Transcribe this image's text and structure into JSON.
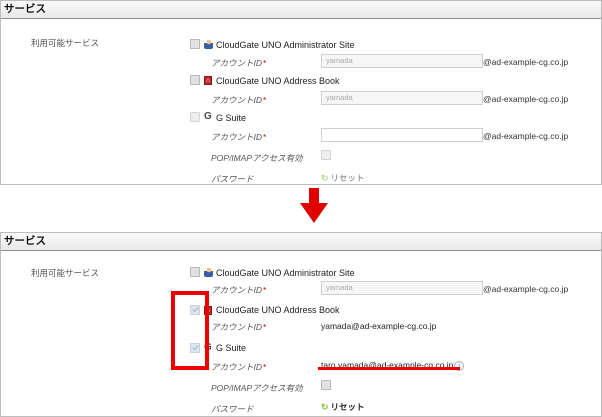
{
  "section_title": "サービス",
  "available_services_label": "利用可能サービス",
  "account_id_label": "アカウントID",
  "required_mark": "*",
  "domain_suffix": "@ad-example-cg.co.jp",
  "pop_imap_label": "POP/IMAPアクセス有効",
  "password_label": "パスワード",
  "reset_label": "リセット",
  "services": {
    "admin": "CloudGate UNO Administrator Site",
    "address_book": "CloudGate UNO Address Book",
    "gsuite": "G Suite"
  },
  "before": {
    "admin_account_placeholder": "yamada",
    "address_book_account_placeholder": "yamada",
    "gsuite_account_value": ""
  },
  "after": {
    "admin_account_placeholder": "yamada",
    "address_book_account_value": "yamada@ad-example-cg.co.jp",
    "gsuite_account_value": "taro.yamada@ad-example-cg.co.jp"
  },
  "colors": {
    "highlight": "#ee0000",
    "reset_icon": "#8bc34a",
    "required": "#d40000"
  },
  "icons": {
    "admin": "admin-user-icon",
    "address_book": "address-book-icon",
    "gsuite": "google-g-icon",
    "reset": "reset-arrow-icon",
    "arrow": "down-arrow-icon",
    "info": "info-icon"
  }
}
